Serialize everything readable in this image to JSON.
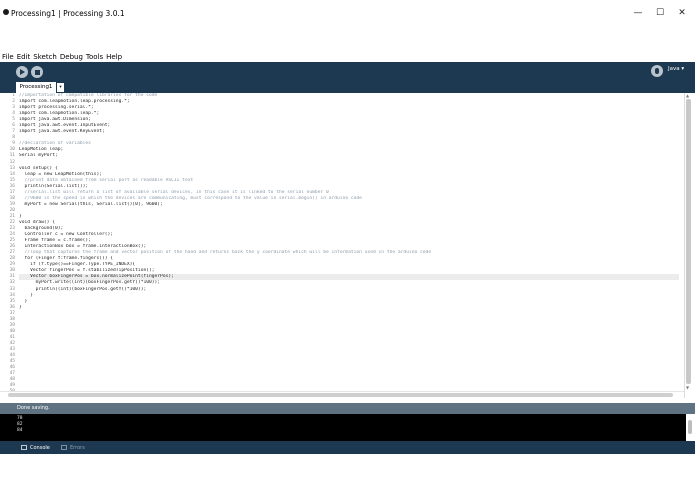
{
  "window": {
    "title": "Processing1 | Processing 3.0.1",
    "minimize": "—",
    "maximize": "☐",
    "close": "✕"
  },
  "menu": [
    "File",
    "Edit",
    "Sketch",
    "Debug",
    "Tools",
    "Help"
  ],
  "toolbar": {
    "run_icon": "play-icon",
    "stop_icon": "stop-icon",
    "debug_icon": "debugger-icon",
    "mode_label": "Java ▾"
  },
  "tabs": {
    "active": "Processing1",
    "menu_arrow": "▾"
  },
  "editor": {
    "line_numbers": [
      "1",
      "2",
      "3",
      "4",
      "5",
      "6",
      "7",
      "8",
      "9",
      "10",
      "11",
      "12",
      "13",
      "14",
      "15",
      "16",
      "17",
      "18",
      "19",
      "20",
      "21",
      "22",
      "23",
      "24",
      "25",
      "26",
      "27",
      "28",
      "29",
      "30",
      "31",
      "32",
      "33",
      "34",
      "35",
      "36",
      "37",
      "38",
      "39",
      "40",
      "41",
      "42",
      "43",
      "44",
      "45",
      "46",
      "47",
      "48",
      "49",
      "50"
    ],
    "lines": [
      "//Importation of compatible libraries for the code",
      "import com.leapmotion.leap.processing.*;",
      "import processing.serial.*;",
      "import com.leapmotion.leap.*;",
      "import java.awt.Dimension;",
      "import java.awt.event.InputEvent;",
      "import java.awt.event.KeyEvent;",
      "",
      "//declaration of variables",
      "LeapMotion leap;",
      "Serial myPort;",
      "",
      "void setup() {",
      "  leap = new LeapMotion(this);",
      "  //print data obtained from serial port as readable ASCII text",
      "  println(Serial.list());",
      "  //serial.list will return a list of available serial devices, in this case it is linked to the serial number 0",
      "  //9600 is the speed in which the devices are communicating, must correspond to the value in serial.begin() in arduino code",
      "  myPort = new Serial(this, Serial.list()[0], 9600);",
      "",
      "}",
      "void draw() {",
      "  background(0);",
      "  Controller c = new Controller();",
      "  Frame frame = c.frame();",
      "  InteractionBox box = frame.interactionBox();",
      "  //loop that captures the frame and vector position of the hand and returns back the y coordinate which will be information used in the arduino code",
      "  for (Finger f:frame.fingers()) {",
      "    if (f.type()==Finger.Type.TYPE_INDEX){",
      "    Vector fingerPos = f.stabilizedTipPosition();",
      "    Vector boxFingerPos = box.normalizePoint(fingerPos);",
      "      myPort.write((int)(boxFingerPos.getY()*100));",
      "      println((int)(boxFingerPos.getY()*100));",
      "    }",
      "  }",
      "}",
      "",
      "",
      "",
      "",
      "",
      "",
      "",
      "",
      "",
      "",
      "",
      "",
      "",
      ""
    ]
  },
  "status": {
    "message": "Done saving."
  },
  "console": {
    "lines": [
      "78",
      "82",
      "84"
    ]
  },
  "console_tabs": {
    "console": "Console",
    "errors": "Errors"
  },
  "colors": {
    "toolbar_bg": "#1d3851",
    "status_bg": "#5f7282",
    "console_bg": "#000000"
  }
}
